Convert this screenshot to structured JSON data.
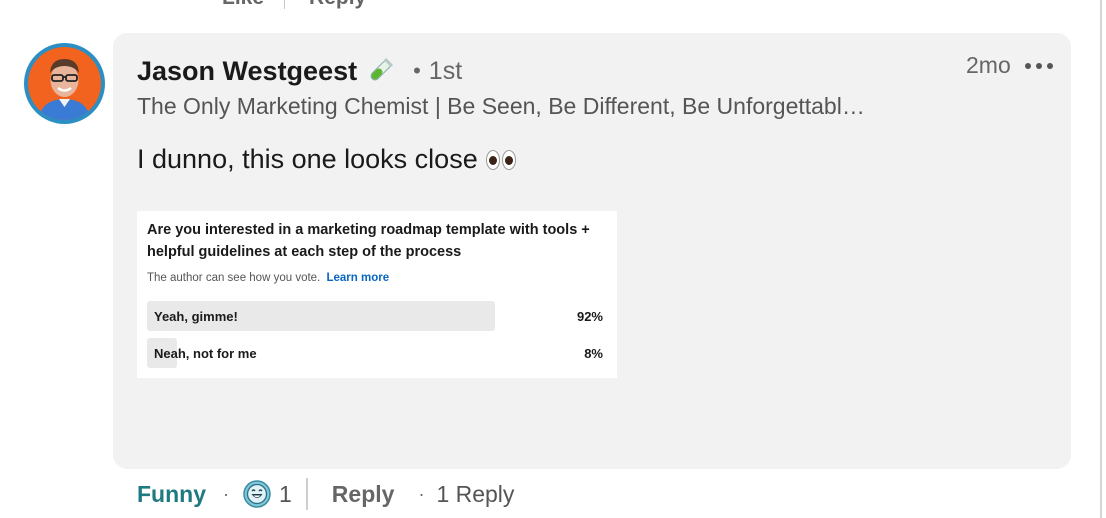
{
  "top_actions": {
    "like_label": "Like",
    "reply_label": "Reply"
  },
  "comment": {
    "author": {
      "name": "Jason Westgeest",
      "badge_icon": "test-tube-icon",
      "degree": "1st",
      "headline": "The Only Marketing Chemist | Be Seen, Be Different, Be Unforgettabl…"
    },
    "time": "2mo",
    "text": "I dunno, this one looks close",
    "text_emoji": "eyes-icon"
  },
  "poll": {
    "question": "Are you interested in a marketing roadmap template with tools + helpful guidelines at each step of the process",
    "note": "The author can see how you vote.",
    "learn_more": "Learn more",
    "options": [
      {
        "label": "Yeah, gimme!",
        "percent": "92%",
        "value": 92
      },
      {
        "label": "Neah, not for me",
        "percent": "8%",
        "value": 8
      }
    ]
  },
  "footer": {
    "reaction_label": "Funny",
    "reaction_icon": "laughing-face-icon",
    "reaction_count": "1",
    "reply_label": "Reply",
    "reply_count": "1 Reply"
  },
  "colors": {
    "accent_teal": "#1f7a80",
    "link_blue": "#0a66c2",
    "avatar_ring": "#2b8fc4",
    "avatar_bg": "#f2631f",
    "bubble_bg": "#f2f2f2"
  }
}
